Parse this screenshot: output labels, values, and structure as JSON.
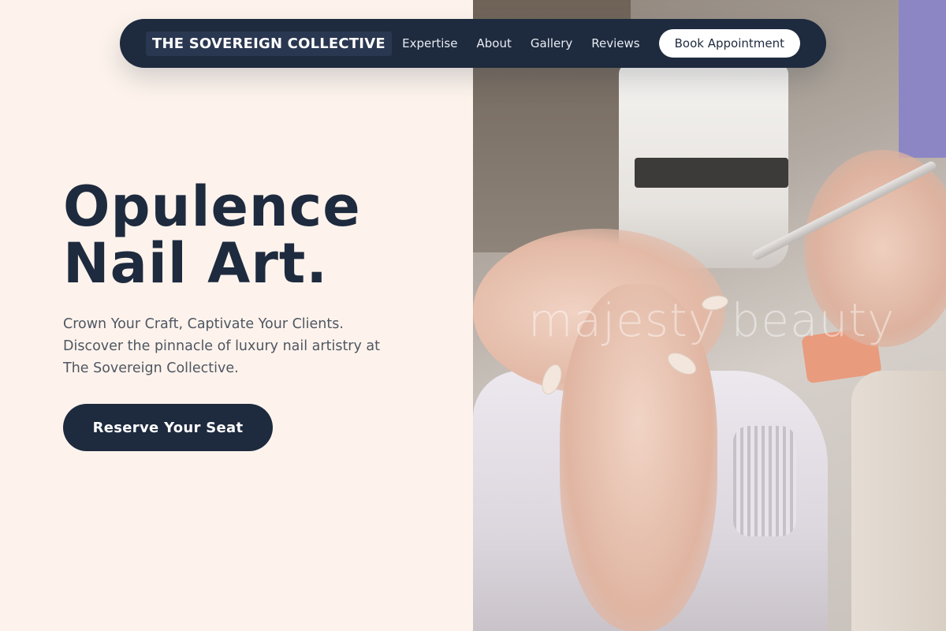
{
  "navbar": {
    "brand": "THE SOVEREIGN COLLECTIVE",
    "links": [
      "Expertise",
      "About",
      "Gallery",
      "Reviews"
    ],
    "book_label": "Book Appointment"
  },
  "hero": {
    "title_line1": "Opulence",
    "title_line2": "Nail Art.",
    "subtitle_line1": "Crown Your Craft, Captivate Your Clients.",
    "subtitle_line2": "Discover the pinnacle of luxury nail artistry at",
    "subtitle_line3": "The Sovereign Collective.",
    "cta_label": "Reserve Your Seat"
  },
  "image": {
    "watermark": "majesty beauty"
  },
  "colors": {
    "navy": "#1e2a3e",
    "cream": "#fdf3ec",
    "text_gray": "#4f5662"
  }
}
